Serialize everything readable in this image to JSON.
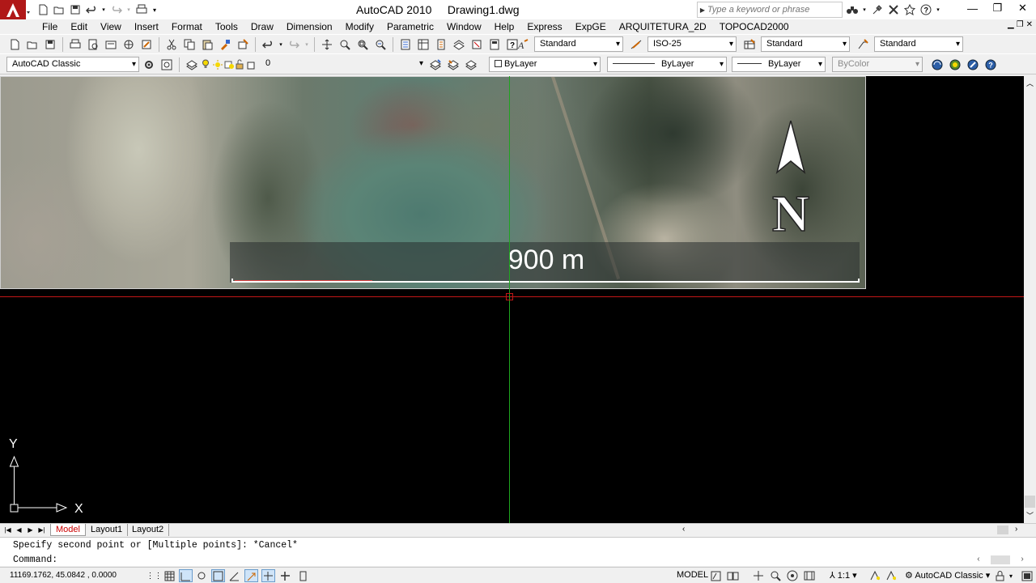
{
  "window": {
    "app_title": "AutoCAD 2010",
    "doc_title": "Drawing1.dwg",
    "search_placeholder": "Type a keyword or phrase"
  },
  "menu": [
    "File",
    "Edit",
    "View",
    "Insert",
    "Format",
    "Tools",
    "Draw",
    "Dimension",
    "Modify",
    "Parametric",
    "Window",
    "Help",
    "Express",
    "ExpGE",
    "ARQUITETURA_2D",
    "TOPOCAD2000"
  ],
  "styles_toolbar": {
    "text_style": "Standard",
    "dim_style": "ISO-25",
    "table_style": "Standard",
    "mleader_style": "Standard"
  },
  "workspace_toolbar": {
    "workspace": "AutoCAD Classic",
    "layer": "0",
    "color": "ByLayer",
    "linetype": "ByLayer",
    "lineweight": "ByLayer",
    "plotstyle": "ByColor"
  },
  "drawing": {
    "scale_label": "900 m",
    "north_label": "N",
    "ucs_x": "X",
    "ucs_y": "Y"
  },
  "tabs": [
    "Model",
    "Layout1",
    "Layout2"
  ],
  "command": {
    "history": "Specify second point or [Multiple points]: *Cancel*",
    "prompt": "Command:"
  },
  "status": {
    "coordinates": "11169.1762, 45.0842 , 0.0000",
    "model": "MODEL",
    "annotation_scale": "1:1",
    "workspace": "AutoCAD Classic"
  },
  "colors": {
    "canvas": "#000000",
    "crosshair_h": "#c21717",
    "crosshair_v": "#1fa51f",
    "active_tab": "#cc0000"
  }
}
